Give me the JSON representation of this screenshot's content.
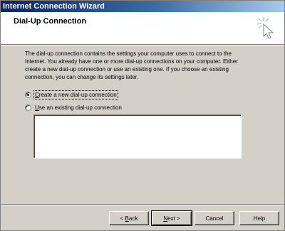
{
  "window": {
    "title": "Internet Connection Wizard"
  },
  "header": {
    "title": "Dial-Up Connection",
    "icon": "wizard-wand-icon"
  },
  "content": {
    "description": "The dial-up connection contains the settings your computer uses to connect to the Internet. You already have one or more dial-up connections on your computer. Either create a new dial-up connection or use an existing one. If you choose an existing connection, you can change its settings later.",
    "options": [
      {
        "label": "Create a new dial-up connection",
        "accel": "C",
        "checked": true
      },
      {
        "label": "Use an existing dial-up connection",
        "accel": "U",
        "checked": false
      }
    ],
    "existing_connections": []
  },
  "buttons": {
    "back": {
      "label": "< Back",
      "accel": "B"
    },
    "next": {
      "label": "Next >",
      "accel": "N"
    },
    "cancel": {
      "label": "Cancel"
    },
    "help": {
      "label": "Help"
    }
  }
}
